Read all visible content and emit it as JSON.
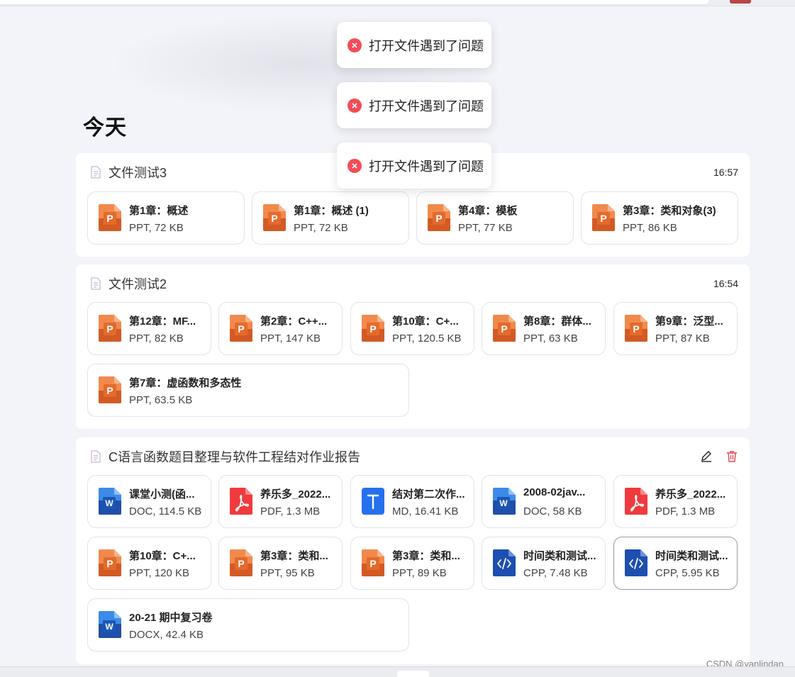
{
  "section": {
    "heading": "今天"
  },
  "toasts": [
    {
      "message": "打开文件遇到了问题"
    },
    {
      "message": "打开文件遇到了问题"
    },
    {
      "message": "打开文件遇到了问题"
    }
  ],
  "groups": [
    {
      "title": "文件测试3",
      "time": "16:57",
      "files": [
        {
          "name": "第1章：概述",
          "meta": "PPT, 72 KB",
          "icon": "ppt-icon"
        },
        {
          "name": "第1章：概述 (1)",
          "meta": "PPT, 72 KB",
          "icon": "ppt-icon"
        },
        {
          "name": "第4章：模板",
          "meta": "PPT, 77 KB",
          "icon": "ppt-icon"
        },
        {
          "name": "第3章：类和对象(3)",
          "meta": "PPT, 86 KB",
          "icon": "ppt-icon"
        }
      ]
    },
    {
      "title": "文件测试2",
      "time": "16:54",
      "files": [
        {
          "name": "第12章：MF...",
          "meta": "PPT, 82 KB",
          "icon": "ppt-icon"
        },
        {
          "name": "第2章：C++...",
          "meta": "PPT, 147 KB",
          "icon": "ppt-icon"
        },
        {
          "name": "第10章：C+...",
          "meta": "PPT, 120.5 KB",
          "icon": "ppt-icon"
        },
        {
          "name": "第8章：群体...",
          "meta": "PPT, 63 KB",
          "icon": "ppt-icon"
        },
        {
          "name": "第9章：泛型...",
          "meta": "PPT, 87 KB",
          "icon": "ppt-icon"
        },
        {
          "name": "第7章：虚函数和多态性",
          "meta": "PPT, 63.5 KB",
          "icon": "ppt-icon"
        }
      ]
    },
    {
      "title": "C语言函数题目整理与软件工程结对作业报告",
      "files": [
        {
          "name": "课堂小测(函...",
          "meta": "DOC, 114.5 KB",
          "icon": "word-icon"
        },
        {
          "name": "养乐多_2022...",
          "meta": "PDF, 1.3 MB",
          "icon": "pdf-icon"
        },
        {
          "name": "结对第二次作...",
          "meta": "MD, 16.41 KB",
          "icon": "text-icon"
        },
        {
          "name": "2008-02jav...",
          "meta": "DOC, 58 KB",
          "icon": "word-icon"
        },
        {
          "name": "养乐多_2022...",
          "meta": "PDF, 1.3 MB",
          "icon": "pdf-icon"
        },
        {
          "name": "第10章：C+...",
          "meta": "PPT, 120 KB",
          "icon": "ppt-icon"
        },
        {
          "name": "第3章：类和...",
          "meta": "PPT, 95 KB",
          "icon": "ppt-icon"
        },
        {
          "name": "第3章：类和...",
          "meta": "PPT, 89 KB",
          "icon": "ppt-icon"
        },
        {
          "name": "时间类和测试...",
          "meta": "CPP, 7.48 KB",
          "icon": "code-icon"
        },
        {
          "name": "时间类和测试...",
          "meta": "CPP, 5.95 KB",
          "icon": "code-icon"
        },
        {
          "name": "20-21 期中复习卷",
          "meta": "DOCX, 42.4 KB",
          "icon": "word-icon"
        }
      ]
    }
  ],
  "watermark": "CSDN @yanlindan",
  "colors": {
    "ppt": "#d35a24",
    "pdf": "#f03a3e",
    "word": "#1f5cc4",
    "text": "#2570ee",
    "error": "#f34d57"
  }
}
